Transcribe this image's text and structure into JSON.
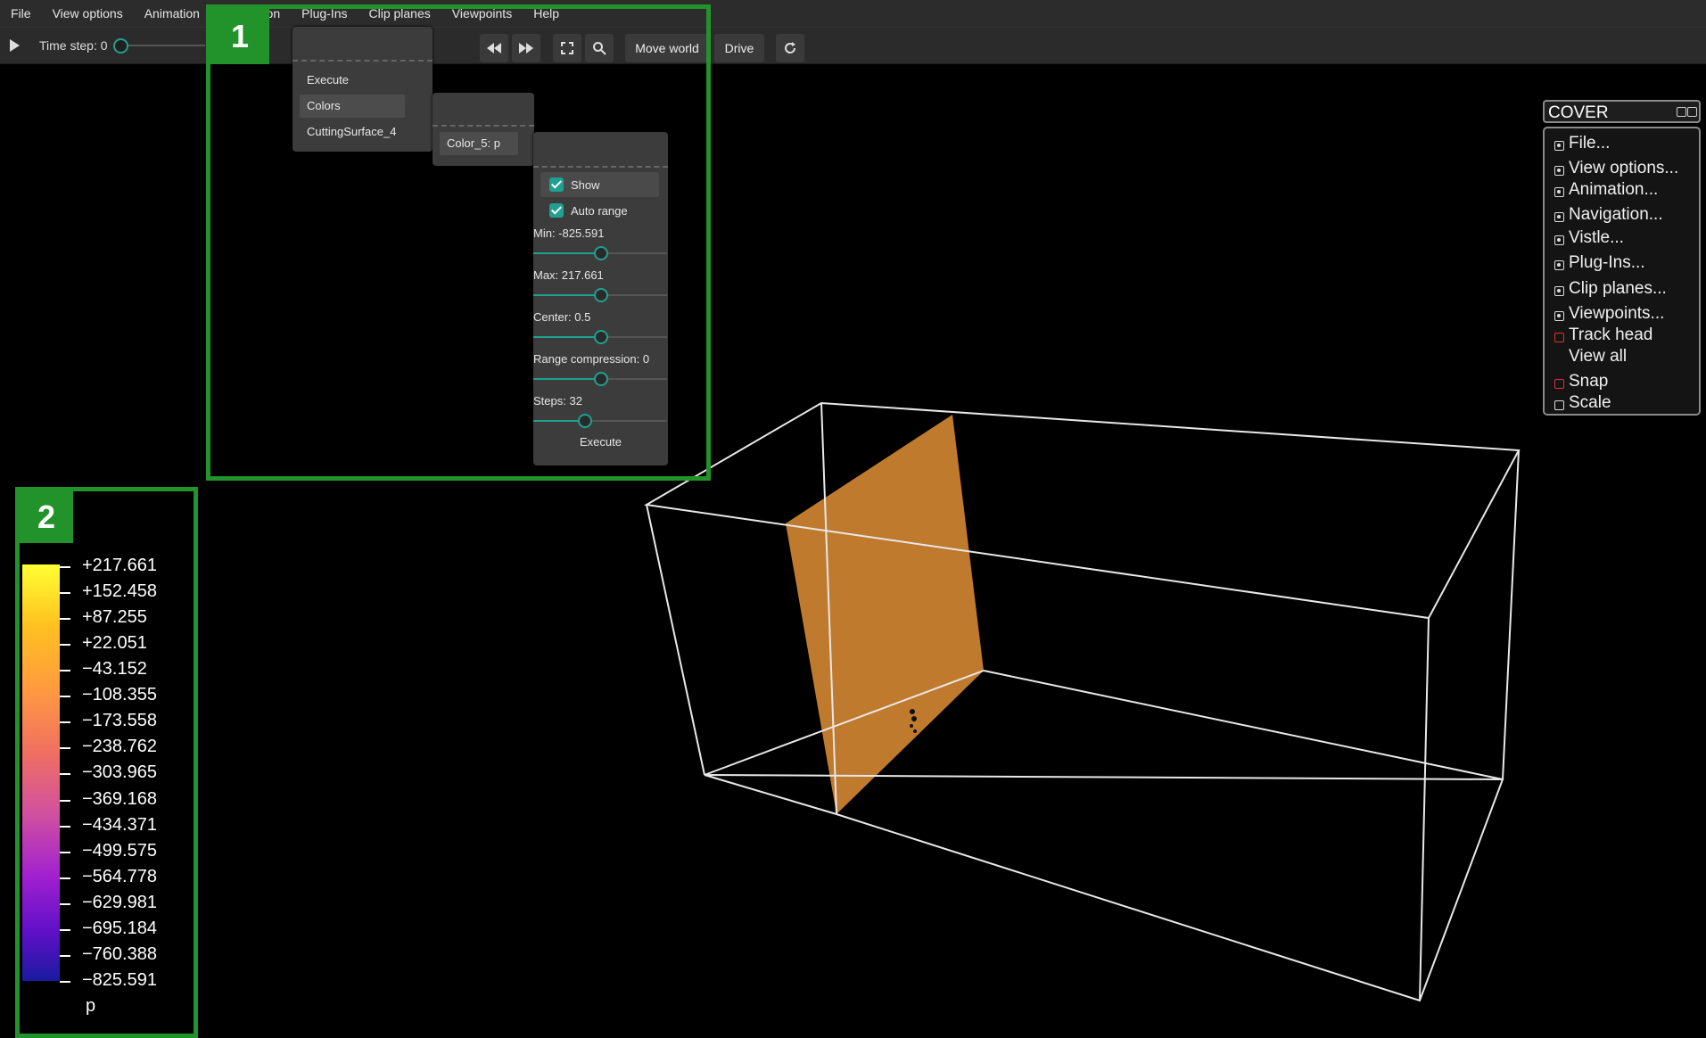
{
  "menubar": {
    "items": [
      "File",
      "View options",
      "Animation",
      "Navigation",
      "Plug-Ins",
      "Clip planes",
      "Viewpoints",
      "Help"
    ]
  },
  "toolbar": {
    "timestep_label": "Time step: 0",
    "timestep_value": 0,
    "move_world": "Move world",
    "drive": "Drive"
  },
  "popup1": {
    "items": [
      "Execute",
      "Colors",
      "CuttingSurface_4"
    ],
    "selected": "Colors"
  },
  "popup2": {
    "item": "Color_5: p"
  },
  "color_panel": {
    "show_label": "Show",
    "show_checked": true,
    "autorange_label": "Auto range",
    "autorange_checked": true,
    "min_label": "Min: -825.591",
    "max_label": "Max: 217.661",
    "center_label": "Center: 0.5",
    "range_label": "Range compression: 0",
    "steps_label": "Steps: 32",
    "execute_label": "Execute"
  },
  "annotations": {
    "box1": "1",
    "box2": "2"
  },
  "legend": {
    "values": [
      "+217.661",
      "+152.458",
      "+87.255",
      "+22.051",
      "−43.152",
      "−108.355",
      "−173.558",
      "−238.762",
      "−303.965",
      "−369.168",
      "−434.371",
      "−499.575",
      "−564.778",
      "−629.981",
      "−695.184",
      "−760.388",
      "−825.591"
    ],
    "name": "p"
  },
  "cover": {
    "title": "COVER",
    "items": [
      "File...",
      "View options...",
      "Animation...",
      "Navigation...",
      "Vistle...",
      "Plug-Ins...",
      "Clip planes...",
      "Viewpoints...",
      "Track head",
      "View all",
      "Snap",
      "Scale"
    ]
  },
  "colors": {
    "accent": "#1fa090",
    "annotation_green": "#22922a",
    "surface_orange": "#c07a2e"
  }
}
